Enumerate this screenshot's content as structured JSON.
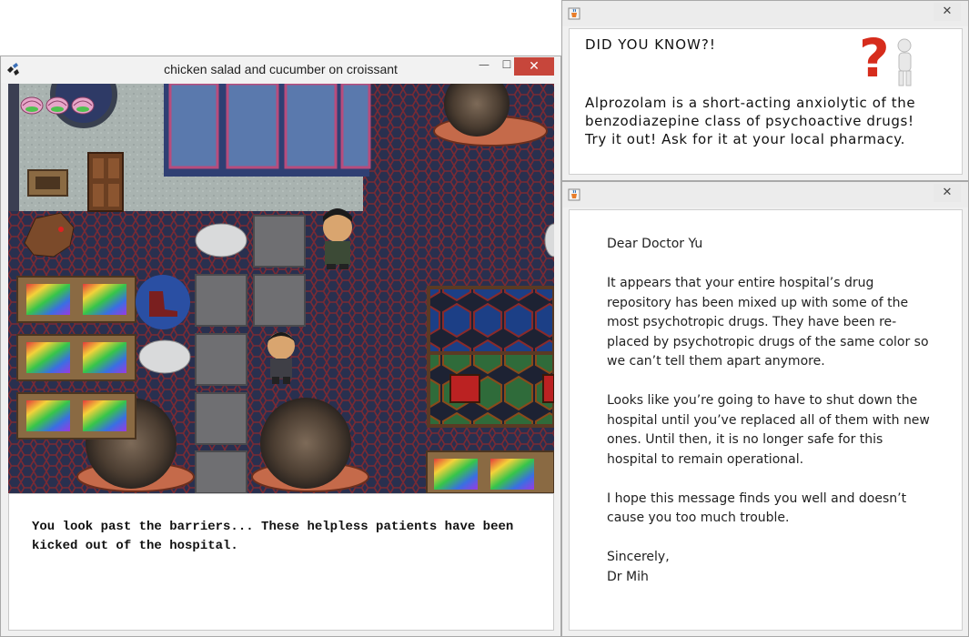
{
  "game_window": {
    "title": "chicken salad and cucumber on croissant",
    "minimize_glyph": "—",
    "maximize_glyph": "☐",
    "close_glyph": "✕",
    "message": "You look past the barriers... These helpless patients have been kicked out of the hospital."
  },
  "popup_fact": {
    "close_glyph": "✕",
    "heading": "DID YOU KNOW?!",
    "body": "Alprozolam is a short-acting anxiolytic of the benzodiazepine class of psychoactive drugs! Try it out! Ask for it at your local pharmacy."
  },
  "popup_letter": {
    "close_glyph": "✕",
    "salutation": "Dear Doctor Yu",
    "paragraphs": [
      "It appears that your entire hospital’s drug repository has been mixed up with some of the most psychotropic drugs. They have been re-placed by psychotropic drugs of the same color so we can’t tell them apart anymore.",
      "Looks like you’re going to have to shut down the hospital until you’ve replaced all of them with new ones. Until then, it is no longer safe for this hospital to remain operational.",
      "I hope this message finds you well and doesn’t cause you too much trouble."
    ],
    "closing": "Sincerely,",
    "signature": "Dr Mih"
  },
  "colors": {
    "close_red": "#c7463b",
    "floor_dark": "#2a2f56",
    "wall_stone": "#a9b3b0"
  },
  "icons": [
    "java-cup-icon",
    "question-person-icon",
    "brain-icon",
    "horse-mask-icon",
    "boots-icon"
  ]
}
